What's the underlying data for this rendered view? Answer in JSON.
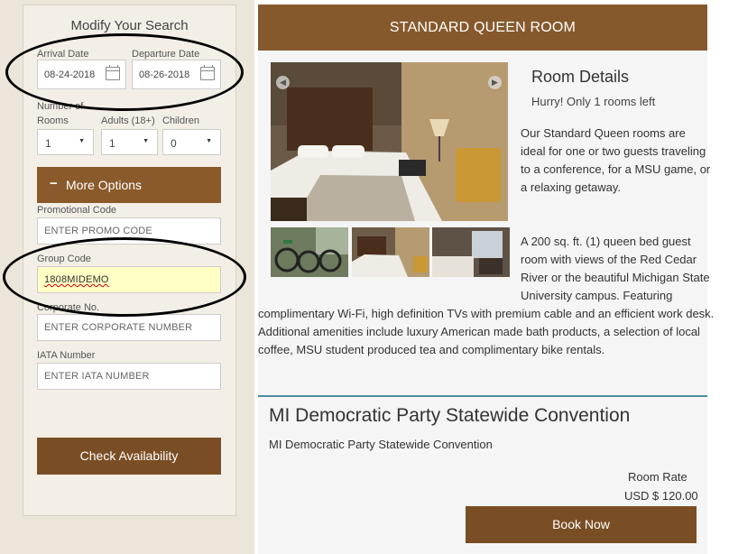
{
  "search": {
    "title": "Modify Your Search",
    "arrival_label": "Arrival Date",
    "arrival_value": "08-24-2018",
    "departure_label": "Departure Date",
    "departure_value": "08-26-2018",
    "rooms_label_line1": "Number of",
    "rooms_label_line2": "Rooms",
    "adults_label": "Adults (18+)",
    "children_label": "Children",
    "rooms_value": "1",
    "adults_value": "1",
    "children_value": "0",
    "more_options_icon": "−",
    "more_options_label": "More Options",
    "promo_label": "Promotional Code",
    "promo_placeholder": "ENTER PROMO CODE",
    "group_label": "Group Code",
    "group_value": "1808MIDEMO",
    "corporate_label": "Corporate No.",
    "corporate_placeholder": "ENTER CORPORATE NUMBER",
    "iata_label": "IATA Number",
    "iata_placeholder": "ENTER IATA NUMBER",
    "check_availability_label": "Check Availability"
  },
  "room": {
    "header": "STANDARD QUEEN ROOM",
    "details_title": "Room Details",
    "rooms_left": "Hurry! Only 1 rooms left",
    "description_lines": [
      "Our Standard Queen rooms are",
      "ideal for one or two guests traveling",
      "to a conference, for a MSU game, or",
      "a relaxing getaway."
    ],
    "amenity_lines_narrow": [
      "A 200 sq. ft. (1) queen bed guest",
      "room with views of the Red Cedar",
      "River or the beautiful Michigan State",
      "University campus. Featuring"
    ],
    "amenity_lines_wide": [
      "complimentary Wi-Fi, high definition TVs with premium cable and an efficient work desk.",
      "Additional amenities include luxury American made bath products, a selection of local",
      "coffee, MSU student produced tea and complimentary bike rentals."
    ]
  },
  "group": {
    "title": "MI Democratic Party Statewide Convention",
    "subtitle": "MI Democratic Party Statewide Convention",
    "rate_label": "Room Rate",
    "rate_value": "USD $ 120.00",
    "book_label": "Book Now"
  }
}
